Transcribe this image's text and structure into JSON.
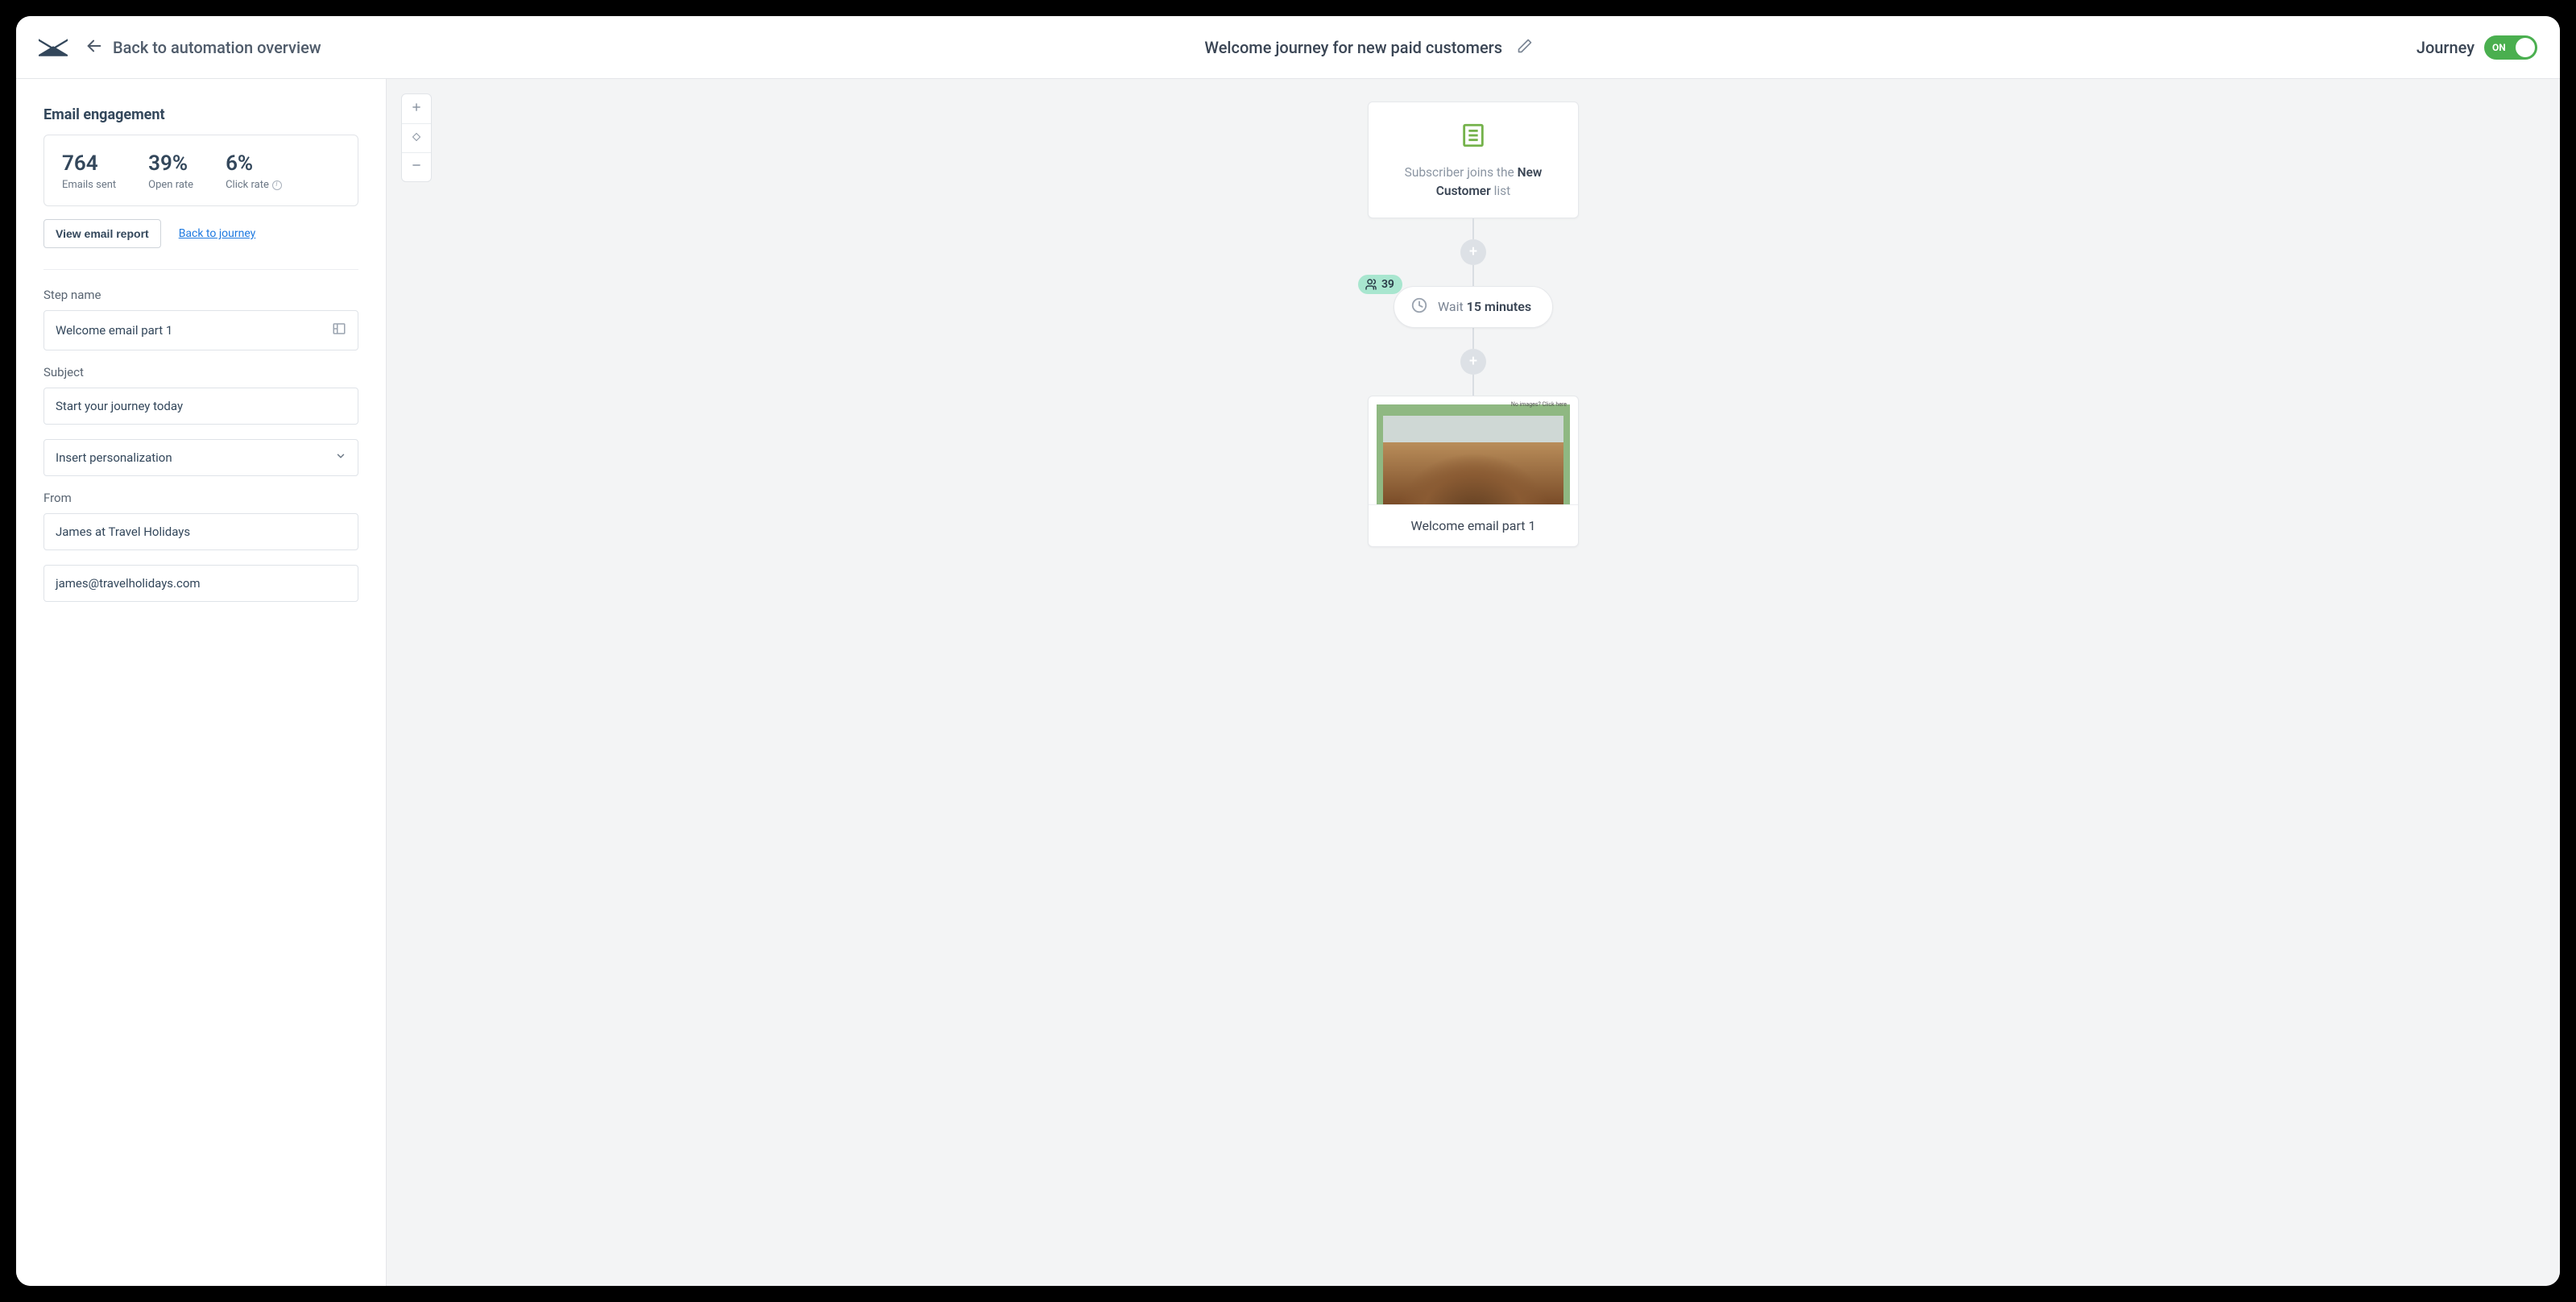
{
  "header": {
    "back_label": "Back to automation overview",
    "title": "Welcome journey for new paid customers",
    "toggle_label": "Journey",
    "toggle_state": "ON"
  },
  "sidebar": {
    "section_title": "Email engagement",
    "stats": {
      "emails_sent": {
        "value": "764",
        "label": "Emails sent"
      },
      "open_rate": {
        "value": "39%",
        "label": "Open rate"
      },
      "click_rate": {
        "value": "6%",
        "label": "Click rate"
      }
    },
    "view_report_label": "View email report",
    "back_to_journey_label": "Back to journey",
    "fields": {
      "step_name": {
        "label": "Step name",
        "value": "Welcome email part 1"
      },
      "subject": {
        "label": "Subject",
        "value": "Start your journey today"
      },
      "personalization": {
        "value": "Insert personalization"
      },
      "from": {
        "label": "From"
      },
      "from_name": {
        "value": "James at Travel Holidays"
      },
      "from_email": {
        "value": "james@travelholidays.com"
      }
    }
  },
  "canvas": {
    "trigger": {
      "prefix": "Subscriber joins the ",
      "list_name": "New Customer",
      "suffix": " list"
    },
    "wait": {
      "count_badge": "39",
      "prefix": "Wait ",
      "duration": "15 minutes"
    },
    "email_node": {
      "caption": "Welcome email part 1",
      "preview_note": "No images? Click here"
    }
  }
}
